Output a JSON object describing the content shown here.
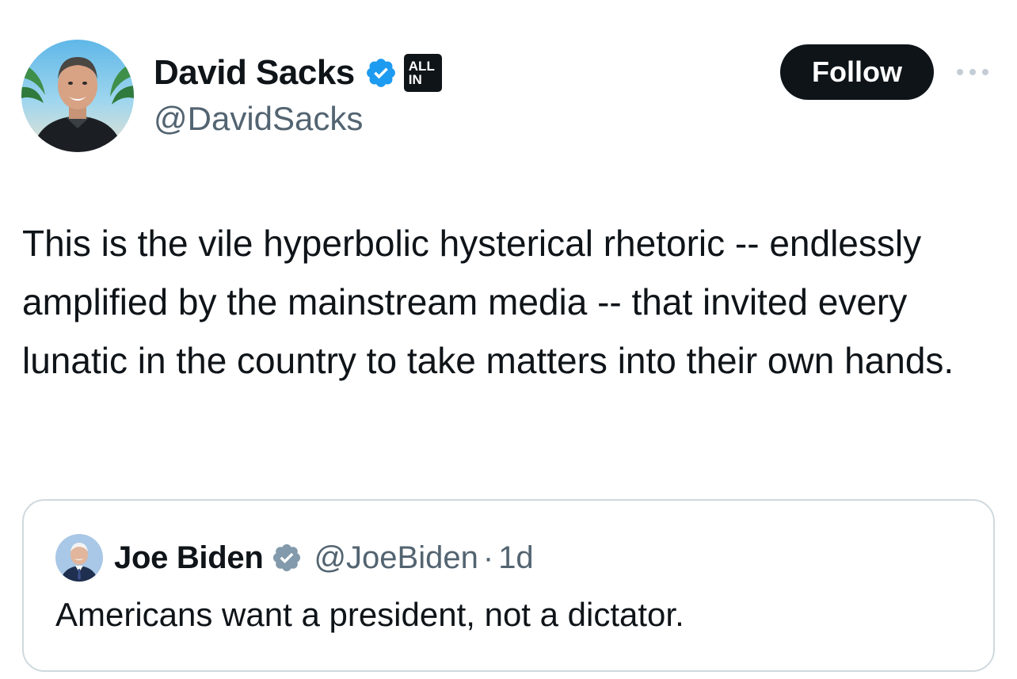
{
  "author": {
    "display_name": "David Sacks",
    "handle": "@DavidSacks",
    "verified_icon": "verified-badge-icon",
    "affiliation_badge_line1": "ALL",
    "affiliation_badge_line2": "IN"
  },
  "actions": {
    "follow_label": "Follow",
    "more_icon": "more-options-icon"
  },
  "tweet": {
    "text": "This is the vile hyperbolic hysterical rhetoric -- endlessly amplified by the mainstream media -- that invited every lunatic in the country to take matters into their own hands."
  },
  "quoted_tweet": {
    "display_name": "Joe Biden",
    "handle": "@JoeBiden",
    "separator": "·",
    "time": "1d",
    "text": "Americans want a president, not a dictator.",
    "verified_icon": "government-verified-icon"
  },
  "colors": {
    "text_primary": "#0f1419",
    "text_secondary": "#536471",
    "verified_blue": "#1d9bf0",
    "verified_gray": "#829aab",
    "border": "#cfd9de",
    "button_bg": "#0f1419"
  }
}
